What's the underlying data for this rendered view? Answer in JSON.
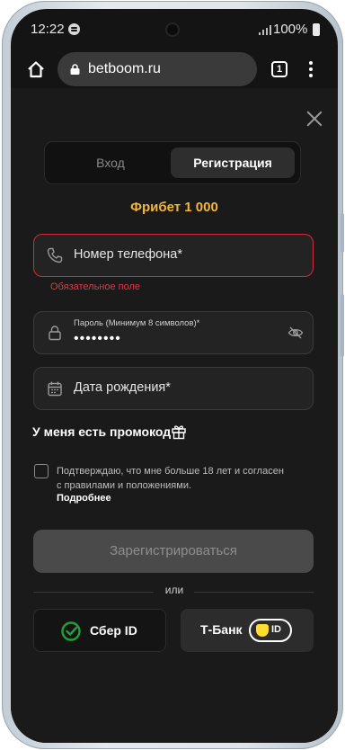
{
  "status_bar": {
    "time": "12:22",
    "battery": "100%"
  },
  "browser": {
    "url": "betboom.ru",
    "tab_count": "1"
  },
  "auth_tabs": {
    "login": "Вход",
    "register": "Регистрация"
  },
  "bonus_text": "Фрибет 1 000",
  "phone_field": {
    "placeholder": "Номер телефона*",
    "error": "Обязательное поле"
  },
  "password_field": {
    "label": "Пароль (Минимум 8 символов)*",
    "value": "••••••••"
  },
  "birthdate_field": {
    "placeholder": "Дата рождения*"
  },
  "promo_label": "У меня есть промокод",
  "consent": {
    "text": "Подтверждаю, что мне больше 18 лет и согласен с правилами и положениями.",
    "more_link": "Подробнее",
    "checked": false
  },
  "register_button": "Зарегистрироваться",
  "divider_text": "или",
  "social": {
    "sber": "Сбер ID",
    "tbank": "Т-Банк",
    "tbank_badge": "ID"
  },
  "colors": {
    "accent": "#f2b73a",
    "error": "#e0384b",
    "sber_green": "#21a038",
    "tbank_yellow": "#ffdd2d"
  }
}
